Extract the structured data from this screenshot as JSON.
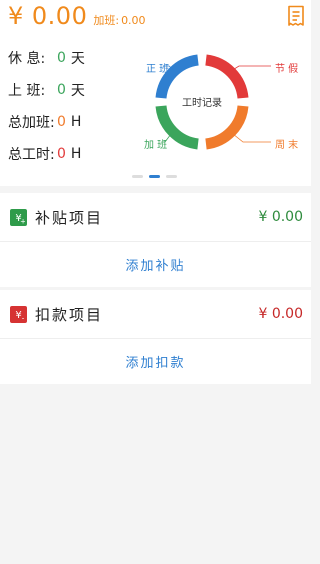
{
  "header": {
    "amount": "¥ 0.00",
    "overtime_label": "加班:",
    "overtime_value": "0.00"
  },
  "stats": [
    {
      "label": "休 息:",
      "value": "0",
      "unit": "天",
      "color": "#3ba55c"
    },
    {
      "label": "上 班:",
      "value": "0",
      "unit": "天",
      "color": "#2f7fd0"
    },
    {
      "label": "总加班:",
      "value": "0",
      "unit": "H",
      "color": "#f07b2c"
    },
    {
      "label": "总工时:",
      "value": "0",
      "unit": "H",
      "color": "#e23a3a"
    }
  ],
  "donut": {
    "center_label": "工时记录",
    "segments": [
      {
        "label": "正 班",
        "color": "#2f7fd0"
      },
      {
        "label": "节 假",
        "color": "#e23a3a"
      },
      {
        "label": "周 末",
        "color": "#f07b2c"
      },
      {
        "label": "加 班",
        "color": "#3ba55c"
      }
    ]
  },
  "pager": {
    "pages": 3,
    "active": 1
  },
  "allowance": {
    "title": "补贴项目",
    "amount": "¥ 0.00",
    "amount_color": "#2e8b3d",
    "action": "添加补贴",
    "icon": "add-allowance-icon",
    "icon_color": "#2e9b4a"
  },
  "deduction": {
    "title": "扣款项目",
    "amount": "¥ 0.00",
    "amount_color": "#c62828",
    "action": "添加扣款",
    "icon": "deduction-icon",
    "icon_color": "#d63333"
  }
}
